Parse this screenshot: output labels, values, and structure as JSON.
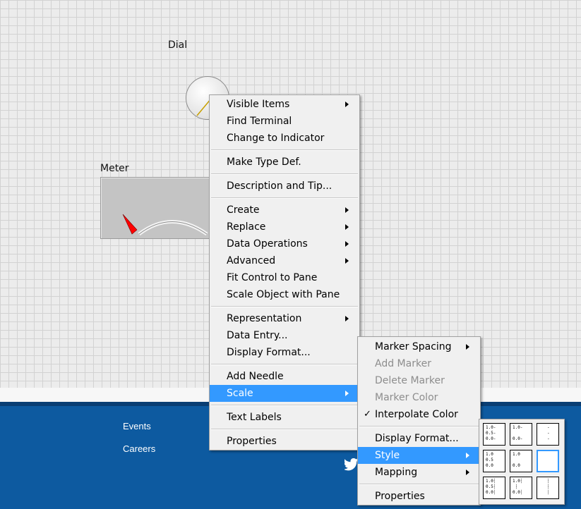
{
  "front_panel": {
    "dial_label": "Dial",
    "meter_label": "Meter"
  },
  "footer": {
    "links": [
      "Events",
      "Careers"
    ],
    "social_icon": "twitter-icon"
  },
  "context_menu": {
    "items": [
      {
        "label": "Visible Items",
        "submenu": true
      },
      {
        "label": "Find Terminal"
      },
      {
        "label": "Change to Indicator"
      },
      {
        "label": "Make Type Def."
      },
      {
        "label": "Description and Tip..."
      },
      {
        "label": "Create",
        "submenu": true
      },
      {
        "label": "Replace",
        "submenu": true
      },
      {
        "label": "Data Operations",
        "submenu": true
      },
      {
        "label": "Advanced",
        "submenu": true
      },
      {
        "label": "Fit Control to Pane"
      },
      {
        "label": "Scale Object with Pane"
      },
      {
        "label": "Representation",
        "submenu": true
      },
      {
        "label": "Data Entry..."
      },
      {
        "label": "Display Format..."
      },
      {
        "label": "Add Needle"
      },
      {
        "label": "Scale",
        "submenu": true,
        "highlighted": true
      },
      {
        "label": "Text Labels"
      },
      {
        "label": "Properties"
      }
    ]
  },
  "scale_submenu": {
    "items": [
      {
        "label": "Marker Spacing",
        "submenu": true
      },
      {
        "label": "Add Marker",
        "disabled": true
      },
      {
        "label": "Delete Marker",
        "disabled": true
      },
      {
        "label": "Marker Color",
        "disabled": true
      },
      {
        "label": "Interpolate Color",
        "checked": true,
        "check_mark": "✓"
      },
      {
        "label": "Display Format..."
      },
      {
        "label": "Style",
        "submenu": true,
        "highlighted": true
      },
      {
        "label": "Mapping",
        "submenu": true
      },
      {
        "label": "Properties"
      }
    ]
  },
  "style_palette": {
    "selected_index": 5,
    "tick_labels": [
      "1.0",
      "0.5",
      "0.0"
    ]
  },
  "colors": {
    "highlight": "#3399ff",
    "footer_blue": "#0d5aa0",
    "needle_red": "#ff0000",
    "dial_needle": "#c8a000"
  }
}
